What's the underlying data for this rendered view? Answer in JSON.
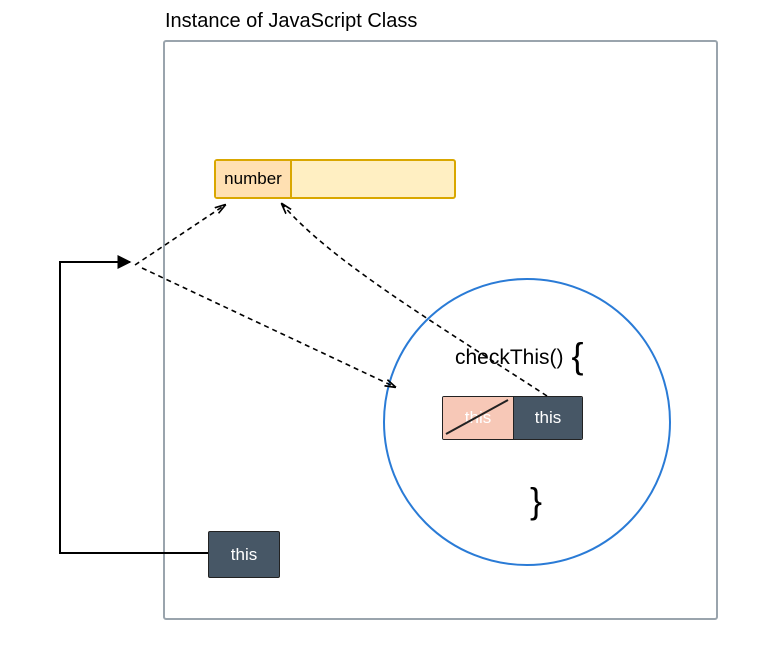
{
  "title": "Instance of JavaScript Class",
  "property": {
    "name": "number"
  },
  "outer_this": "this",
  "method": {
    "name": "checkThis()",
    "brace_open": "{",
    "brace_close": "}",
    "this_crossed": "this",
    "this_active": "this"
  }
}
